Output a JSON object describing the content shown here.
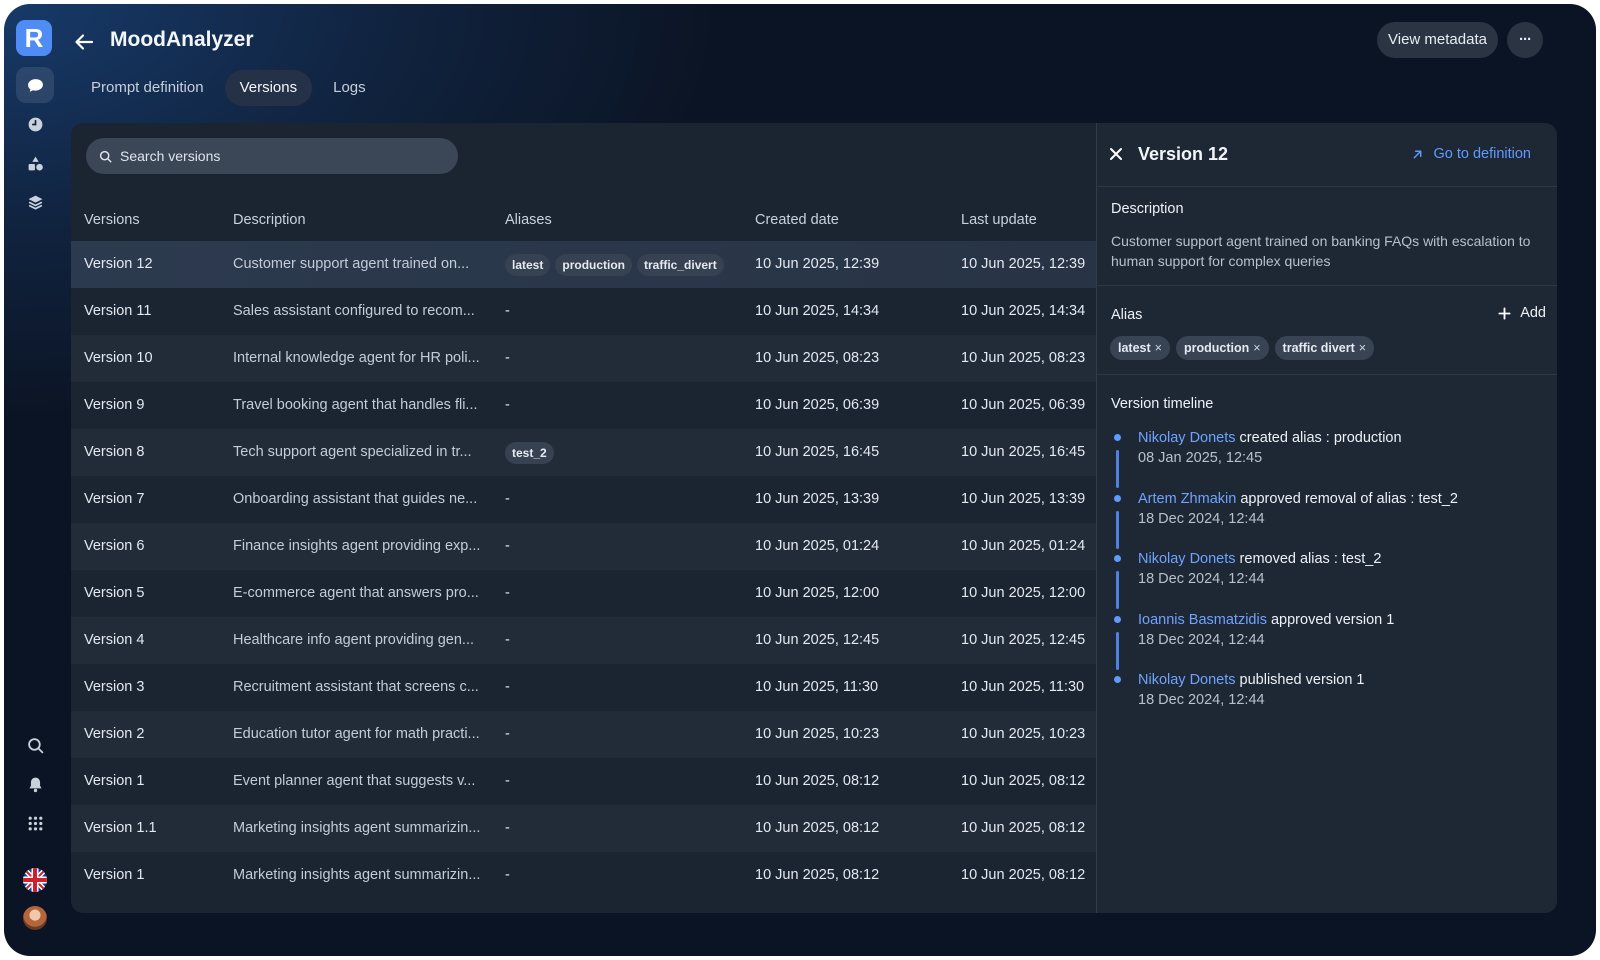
{
  "app": {
    "title": "MoodAnalyzer",
    "logo_letter": "R"
  },
  "header": {
    "view_metadata_label": "View metadata",
    "more_label": "···"
  },
  "tabs": [
    {
      "label": "Prompt definition",
      "active": false
    },
    {
      "label": "Versions",
      "active": true
    },
    {
      "label": "Logs",
      "active": false
    }
  ],
  "search": {
    "placeholder": "Search versions"
  },
  "table": {
    "columns": [
      "Versions",
      "Description",
      "Aliases",
      "Created date",
      "Last update"
    ],
    "rows": [
      {
        "version": "Version 12",
        "description": "Customer support agent trained on...",
        "aliases": [
          "latest",
          "production",
          "traffic_divert"
        ],
        "created": "10 Jun 2025, 12:39",
        "updated": "10 Jun 2025, 12:39"
      },
      {
        "version": "Version 11",
        "description": "Sales assistant configured to recom...",
        "aliases": [],
        "created": "10 Jun 2025, 14:34",
        "updated": "10 Jun 2025, 14:34"
      },
      {
        "version": "Version 10",
        "description": "Internal knowledge agent for HR poli...",
        "aliases": [],
        "created": "10 Jun 2025, 08:23",
        "updated": "10 Jun 2025, 08:23"
      },
      {
        "version": "Version 9",
        "description": "Travel booking agent that handles fli...",
        "aliases": [],
        "created": "10 Jun 2025, 06:39",
        "updated": "10 Jun 2025, 06:39"
      },
      {
        "version": "Version 8",
        "description": "Tech support agent specialized in tr...",
        "aliases": [
          "test_2"
        ],
        "created": "10 Jun 2025, 16:45",
        "updated": "10 Jun 2025, 16:45"
      },
      {
        "version": "Version 7",
        "description": "Onboarding assistant that guides ne...",
        "aliases": [],
        "created": "10 Jun 2025, 13:39",
        "updated": "10 Jun 2025, 13:39"
      },
      {
        "version": "Version 6",
        "description": "Finance insights agent providing exp...",
        "aliases": [],
        "created": "10 Jun 2025, 01:24",
        "updated": "10 Jun 2025, 01:24"
      },
      {
        "version": "Version 5",
        "description": "E-commerce agent that answers pro...",
        "aliases": [],
        "created": "10 Jun 2025, 12:00",
        "updated": "10 Jun 2025, 12:00"
      },
      {
        "version": "Version 4",
        "description": "Healthcare info agent providing gen...",
        "aliases": [],
        "created": "10 Jun 2025, 12:45",
        "updated": "10 Jun 2025, 12:45"
      },
      {
        "version": "Version 3",
        "description": "Recruitment assistant that screens c...",
        "aliases": [],
        "created": "10 Jun 2025, 11:30",
        "updated": "10 Jun 2025, 11:30"
      },
      {
        "version": "Version 2",
        "description": "Education tutor agent for math practi...",
        "aliases": [],
        "created": "10 Jun 2025, 10:23",
        "updated": "10 Jun 2025, 10:23"
      },
      {
        "version": "Version 1",
        "description": "Event planner agent that suggests v...",
        "aliases": [],
        "created": "10 Jun 2025, 08:12",
        "updated": "10 Jun 2025, 08:12"
      },
      {
        "version": "Version 1.1",
        "description": "Marketing insights agent summarizin...",
        "aliases": [],
        "created": "10 Jun 2025, 08:12",
        "updated": "10 Jun 2025, 08:12"
      },
      {
        "version": "Version 1",
        "description": "Marketing insights agent summarizin...",
        "aliases": [],
        "created": "10 Jun 2025, 08:12",
        "updated": "10 Jun 2025, 08:12"
      }
    ],
    "empty_alias": "-"
  },
  "detail": {
    "title": "Version 12",
    "go_to_definition": "Go to definition",
    "description_label": "Description",
    "description": "Customer support agent trained on banking FAQs with escalation to human support for complex queries",
    "alias_label": "Alias",
    "add_label": "Add",
    "aliases": [
      "latest",
      "production",
      "traffic divert"
    ],
    "timeline_label": "Version timeline",
    "timeline": [
      {
        "user": "Nikolay Donets",
        "action": "created alias : production",
        "date": "08 Jan 2025, 12:45"
      },
      {
        "user": "Artem Zhmakin",
        "action": "approved removal of alias : test_2",
        "date": "18 Dec 2024, 12:44"
      },
      {
        "user": "Nikolay Donets",
        "action": "removed alias : test_2",
        "date": "18 Dec 2024, 12:44"
      },
      {
        "user": "Ioannis Basmatzidis",
        "action": "approved version 1",
        "date": "18 Dec 2024, 12:44"
      },
      {
        "user": "Nikolay Donets",
        "action": "published version 1",
        "date": "18 Dec 2024, 12:44"
      }
    ]
  },
  "sidebar": {
    "top_icons": [
      "chat-icon",
      "clock-icon",
      "shapes-icon",
      "layers-icon"
    ],
    "bottom_icons": [
      "search-icon",
      "bell-icon",
      "apps-grid-icon",
      "uk-flag-icon",
      "avatar"
    ]
  },
  "colors": {
    "accent": "#5f9bff",
    "brand": "#4f8cf5",
    "panel": "#1b2431"
  }
}
